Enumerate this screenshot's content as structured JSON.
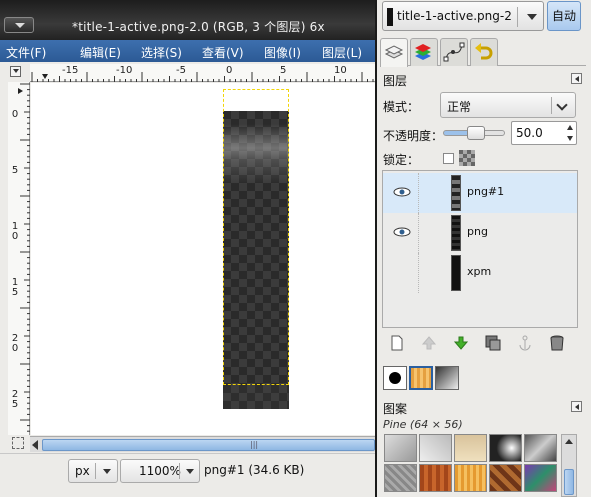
{
  "image_window": {
    "title": "*title-1-active.png-2.0 (RGB, 3 个图层) 6x",
    "menu": [
      "文件(F)",
      "编辑(E)",
      "选择(S)",
      "查看(V)",
      "图像(I)",
      "图层(L)"
    ],
    "hruler_labels": [
      "-15",
      "-10",
      "-5",
      "0",
      "5",
      "10"
    ],
    "vruler_labels": [
      [
        "0"
      ],
      [
        "5"
      ],
      [
        "1",
        "0"
      ],
      [
        "1",
        "5"
      ],
      [
        "2",
        "0"
      ],
      [
        "2",
        "5"
      ]
    ],
    "statusbar": {
      "unit": "px",
      "zoom": "1100%",
      "status": "png#1 (34.6 KB)"
    }
  },
  "dock": {
    "image_selector": "title-1-active.png-2",
    "auto_button": "自动",
    "layers": {
      "title": "图层",
      "mode_label": "模式：",
      "mode_value": "正常",
      "opacity_label": "不透明度：",
      "opacity_value": "50.0",
      "opacity_fraction": 0.5,
      "lock_label": "锁定：",
      "items": [
        {
          "name": "png#1",
          "visible": true,
          "selected": true
        },
        {
          "name": "png",
          "visible": true,
          "selected": false
        },
        {
          "name": "xpm",
          "visible": false,
          "selected": false
        }
      ]
    },
    "patterns": {
      "title": "图案",
      "current": "Pine (64 × 56)"
    }
  }
}
